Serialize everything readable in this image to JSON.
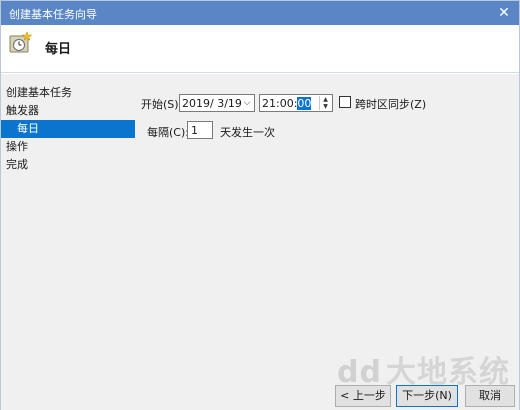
{
  "window": {
    "title": "创建基本任务向导",
    "close_glyph": "✕"
  },
  "header": {
    "heading": "每日",
    "icon": "task-clock-icon"
  },
  "sidebar": {
    "items": [
      {
        "label": "创建基本任务",
        "active": false
      },
      {
        "label": "触发器",
        "active": false
      },
      {
        "label": "每日",
        "active": true
      },
      {
        "label": "操作",
        "active": false
      },
      {
        "label": "完成",
        "active": false
      }
    ]
  },
  "form": {
    "start_label": "开始(S):",
    "start_date": "2019/ 3/19",
    "start_time_prefix": "21:00:",
    "start_time_selected": "00",
    "sync_timezone_label": "跨时区同步(Z)",
    "sync_timezone_checked": false,
    "recur_label": "每隔(C):",
    "recur_value": "1",
    "recur_unit": "天发生一次"
  },
  "buttons": {
    "back": "< 上一步(B)",
    "next": "下一步(N) >",
    "cancel": "取消"
  },
  "watermark": {
    "glyph": "dd",
    "text": "大地系统"
  },
  "colors": {
    "titlebar": "#5b86c5",
    "selection": "#0a74cf",
    "panel": "#f0f0f0"
  }
}
